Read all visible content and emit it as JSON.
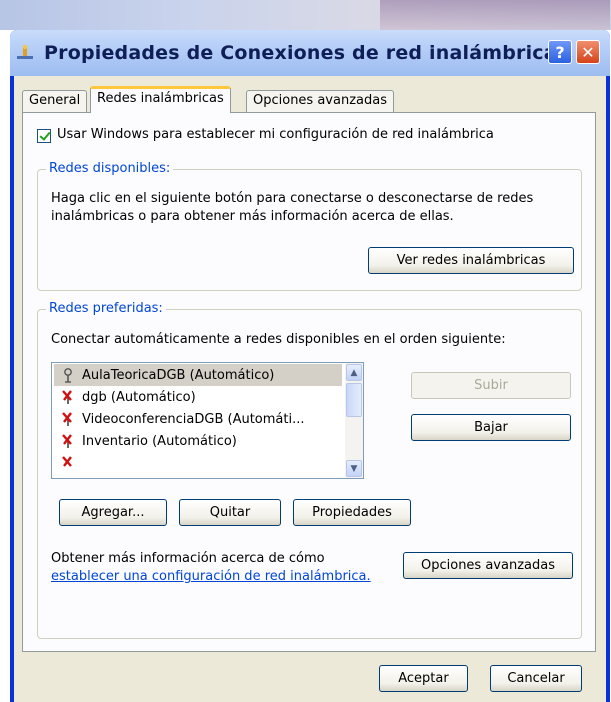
{
  "window": {
    "title": "Propiedades de Conexiones de red inalámbricas",
    "help_label": "?",
    "close_label": "✕"
  },
  "tabs": [
    {
      "label": "General",
      "active": false
    },
    {
      "label": "Redes inalámbricas",
      "active": true
    },
    {
      "label": "Opciones avanzadas",
      "active": false
    }
  ],
  "use_windows": {
    "checked": true,
    "label": "Usar Windows para establecer mi configuración de red inalámbrica"
  },
  "available": {
    "title": "Redes disponibles:",
    "text": "Haga clic en el siguiente botón para conectarse o desconectarse de redes inalámbricas o para obtener más información acerca de ellas.",
    "view_button": "Ver redes inalámbricas"
  },
  "preferred": {
    "title": "Redes preferidas:",
    "text": "Conectar automáticamente a redes disponibles en el orden siguiente:",
    "networks": [
      {
        "name": "AulaTeoricaDGB (Automático)",
        "status": "connected",
        "selected": true
      },
      {
        "name": "dgb (Automático)",
        "status": "unavailable",
        "selected": false
      },
      {
        "name": "VideoconferenciaDGB (Automáti...",
        "status": "unavailable",
        "selected": false
      },
      {
        "name": "Inventario (Automático)",
        "status": "unavailable",
        "selected": false
      },
      {
        "name": "",
        "status": "unavailable",
        "selected": false
      }
    ],
    "up_button": "Subir",
    "down_button": "Bajar",
    "add_button": "Agregar...",
    "remove_button": "Quitar",
    "properties_button": "Propiedades",
    "info_text": "Obtener más información acerca de cómo",
    "info_link": "establecer una configuración de red inalámbrica.",
    "advanced_button": "Opciones avanzadas"
  },
  "footer": {
    "ok_button": "Aceptar",
    "cancel_button": "Cancelar"
  },
  "colors": {
    "title_text": "#0f1e57",
    "group_title": "#0046d5",
    "active_tab_accent": "#ffc83c",
    "window_face": "#ece9d8"
  },
  "icons": {
    "title": "network-connection-icon",
    "connected": "antenna-icon",
    "unavailable": "antenna-red-x-icon"
  }
}
